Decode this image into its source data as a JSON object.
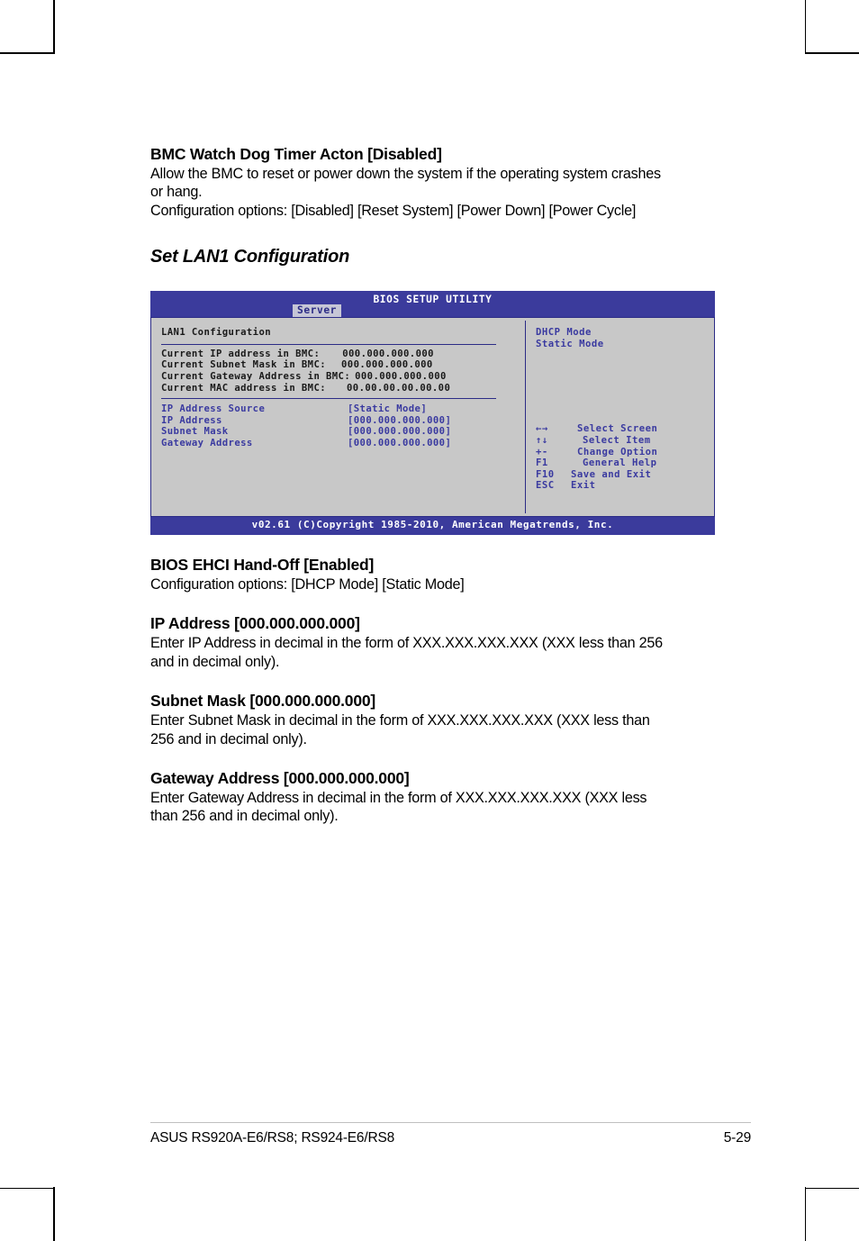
{
  "sections": [
    {
      "heading": "BMC Watch Dog Timer Acton [Disabled]",
      "body_lines": [
        "Allow the BMC to reset or power down the system if the operating system crashes",
        "or hang.",
        "Configuration options: [Disabled] [Reset System] [Power Down] [Power Cycle]"
      ]
    }
  ],
  "subsection_title": "Set LAN1 Configuration",
  "bios": {
    "title": "BIOS SETUP UTILITY",
    "tab": "Server",
    "panel_heading": "LAN1 Configuration",
    "current_rows": [
      {
        "label": "Current IP address in BMC:",
        "value": "000.000.000.000"
      },
      {
        "label": "Current Subnet Mask in BMC:",
        "value": "000.000.000.000"
      },
      {
        "label": "Current Gateway Address in BMC:",
        "value": "000.000.000.000"
      },
      {
        "label": "Current MAC address in BMC:",
        "value": "00.00.00.00.00.00"
      }
    ],
    "option_rows": [
      {
        "label": "IP Address Source",
        "value": "[Static Mode]"
      },
      {
        "label": "IP Address",
        "value": "[000.000.000.000]"
      },
      {
        "label": "Subnet Mask",
        "value": "[000.000.000.000]"
      },
      {
        "label": "Gateway Address",
        "value": "[000.000.000.000]"
      }
    ],
    "help_items": [
      "DHCP Mode",
      "Static Mode"
    ],
    "key_legend": [
      {
        "key": "←→",
        "desc": "Select Screen"
      },
      {
        "key": "↑↓",
        "desc": "Select Item"
      },
      {
        "key": "+-",
        "desc": "Change Option"
      },
      {
        "key": "F1",
        "desc": "General Help"
      },
      {
        "key": "F10",
        "desc": "Save and Exit"
      },
      {
        "key": "ESC",
        "desc": "Exit"
      }
    ],
    "footer": "v02.61 (C)Copyright 1985-2010, American Megatrends, Inc.",
    "colors": {
      "bar": "#3b3b9c",
      "panel_bg": "#c8c8c8",
      "text_blue": "#3a3aa0",
      "border_blue": "#2b2b86",
      "tab_bg": "#c6c6d6"
    }
  },
  "sections_after": [
    {
      "heading": "BIOS EHCI Hand-Off [Enabled]",
      "body_lines": [
        "Configuration options: [DHCP Mode] [Static Mode]"
      ]
    },
    {
      "heading": "IP Address [000.000.000.000]",
      "body_lines": [
        "Enter IP Address in decimal in the form of XXX.XXX.XXX.XXX (XXX less than 256",
        "and in decimal only)."
      ]
    },
    {
      "heading": "Subnet Mask [000.000.000.000]",
      "body_lines": [
        "Enter Subnet Mask in decimal in the form of XXX.XXX.XXX.XXX (XXX less than",
        "256 and in decimal only)."
      ]
    },
    {
      "heading": "Gateway Address [000.000.000.000]",
      "body_lines": [
        "Enter Gateway Address in decimal in the form of XXX.XXX.XXX.XXX (XXX less",
        "than 256 and in decimal only)."
      ]
    }
  ],
  "page_footer": {
    "left": "ASUS RS920A-E6/RS8; RS924-E6/RS8",
    "right": "5-29"
  }
}
